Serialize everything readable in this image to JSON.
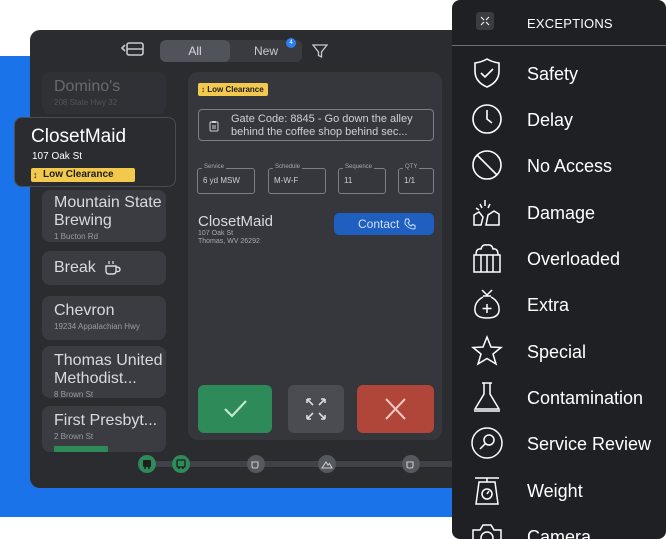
{
  "tabs": {
    "all": "All",
    "new": "New",
    "new_badge": "4"
  },
  "route": [
    {
      "name": "Domino's",
      "address": "208 State Hwy 32"
    },
    {
      "name": "Mountain State Brewing",
      "address": "1 Bucton Rd"
    },
    {
      "name": "Chevron",
      "address": "19234 Appalachian Hwy"
    },
    {
      "name": "Thomas United Methodist...",
      "address": "8 Brown St"
    },
    {
      "name": "First Presbyt...",
      "address": "2 Brown St"
    }
  ],
  "break_label": "Break",
  "selected_stop": {
    "name": "ClosetMaid",
    "address": "107 Oak St",
    "tag": "Low Clearance"
  },
  "detail": {
    "tag": "Low Clearance",
    "gate_note": "Gate Code: 8845 - Go down the alley behind the coffee shop behind sec...",
    "fields": {
      "service_label": "Service",
      "service": "6 yd MSW",
      "schedule_label": "Schedule",
      "schedule": "M-W-F",
      "sequence_label": "Sequence",
      "sequence": "11",
      "qty_label": "QTY",
      "qty": "1/1"
    },
    "customer": {
      "name": "ClosetMaid",
      "address1": "107 Oak St",
      "address2": "Thomas, WV 26292"
    },
    "contact_label": "Contact"
  },
  "exceptions_menu": {
    "title": "EXCEPTIONS",
    "items": [
      {
        "label": "Safety",
        "icon": "shield-check-icon"
      },
      {
        "label": "Delay",
        "icon": "clock-icon"
      },
      {
        "label": "No Access",
        "icon": "no-entry-icon"
      },
      {
        "label": "Damage",
        "icon": "damage-icon"
      },
      {
        "label": "Overloaded",
        "icon": "overloaded-bin-icon"
      },
      {
        "label": "Extra",
        "icon": "extra-bag-icon"
      },
      {
        "label": "Special",
        "icon": "star-icon"
      },
      {
        "label": "Contamination",
        "icon": "flask-icon"
      },
      {
        "label": "Service Review",
        "icon": "search-icon"
      },
      {
        "label": "Weight",
        "icon": "scale-icon"
      },
      {
        "label": "Camera",
        "icon": "camera-icon"
      }
    ]
  },
  "colors": {
    "brand_blue": "#1a73e8",
    "tag_yellow": "#f2c94c",
    "complete_green": "#2e8a58",
    "skip_red": "#b0463a",
    "contact_blue": "#1f5fbf"
  }
}
